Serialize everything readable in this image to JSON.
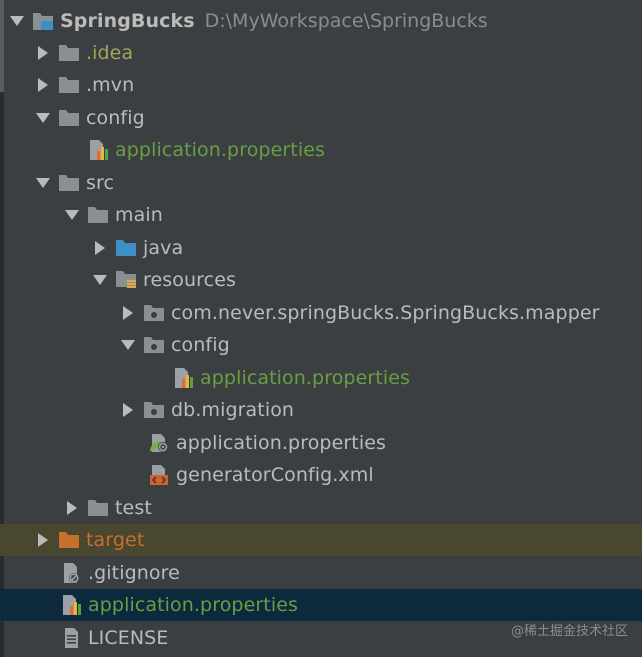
{
  "project": {
    "name": "SpringBucks",
    "path": "D:\\MyWorkspace\\SpringBucks"
  },
  "rows": [
    {
      "label": "SpringBucks"
    },
    {
      "label": ".idea"
    },
    {
      "label": ".mvn"
    },
    {
      "label": "config"
    },
    {
      "label": "application.properties"
    },
    {
      "label": "src"
    },
    {
      "label": "main"
    },
    {
      "label": "java"
    },
    {
      "label": "resources"
    },
    {
      "label": "com.never.springBucks.SpringBucks.mapper"
    },
    {
      "label": "config"
    },
    {
      "label": "application.properties"
    },
    {
      "label": "db.migration"
    },
    {
      "label": "application.properties"
    },
    {
      "label": "generatorConfig.xml"
    },
    {
      "label": "test"
    },
    {
      "label": "target"
    },
    {
      "label": ".gitignore"
    },
    {
      "label": "application.properties"
    },
    {
      "label": "LICENSE"
    }
  ],
  "colors": {
    "background": "#3c3f41",
    "text": "#bbbbbb",
    "path_text": "#8c8c8c",
    "properties_green": "#6a9e43",
    "idea_olive": "#a3a35a",
    "target_orange": "#c5702c",
    "excluded_row_bg": "#49472f",
    "selected_row_bg": "#0d293e",
    "folder_gray": "#8a8f93",
    "source_folder_blue": "#3d8fc6"
  },
  "selected_row": "application.properties",
  "watermark": "@稀土掘金技术社区"
}
